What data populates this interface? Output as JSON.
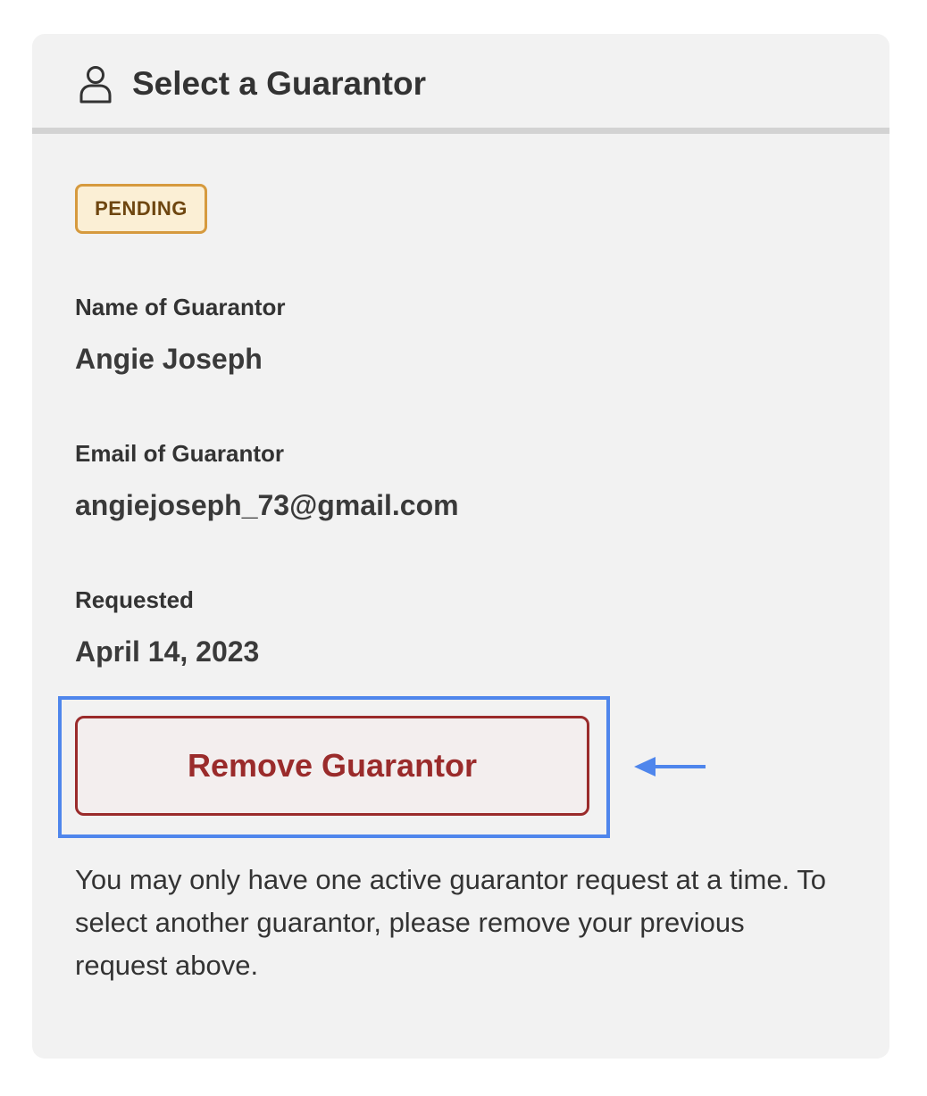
{
  "header": {
    "icon": "user-icon",
    "title": "Select a Guarantor"
  },
  "status": {
    "label": "PENDING",
    "border_color": "#d69a3e",
    "background_color": "#fbefd5",
    "text_color": "#6e4610"
  },
  "fields": [
    {
      "label": "Name of Guarantor",
      "value": "Angie Joseph"
    },
    {
      "label": "Email of Guarantor",
      "value": "angiejoseph_73@gmail.com"
    },
    {
      "label": "Requested",
      "value": "April 14, 2023"
    }
  ],
  "actions": {
    "remove_label": "Remove Guarantor",
    "remove_color": "#9a2b2b"
  },
  "annotation": {
    "highlight_color": "#4f86ec",
    "arrow_icon": "arrow-left-icon"
  },
  "info_text": "You may only have one active guarantor request at a time. To select another guarantor, please remove your previous request above."
}
